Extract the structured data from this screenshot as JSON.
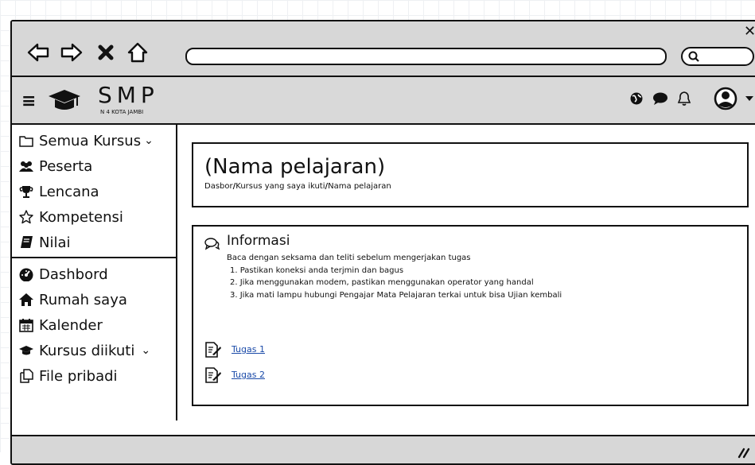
{
  "browser": {
    "back_icon": "back-arrow-icon",
    "forward_icon": "forward-arrow-icon",
    "stop_icon": "close-icon",
    "home_icon": "home-icon",
    "address_value": "",
    "search_icon": "search-icon"
  },
  "header": {
    "logo_title": "SMP",
    "logo_subtitle": "N 4 KOTA JAMBI"
  },
  "sidebar": {
    "items": [
      {
        "label": "Semua Kursus",
        "icon": "folder-icon"
      },
      {
        "label": "Peserta",
        "icon": "users-icon"
      },
      {
        "label": "Lencana",
        "icon": "trophy-icon"
      },
      {
        "label": "Kompetensi",
        "icon": "star-icon"
      },
      {
        "label": "Nilai",
        "icon": "book-icon"
      },
      {
        "label": "Dashbord",
        "icon": "dashboard-icon"
      },
      {
        "label": "Rumah saya",
        "icon": "home-icon"
      },
      {
        "label": "Kalender",
        "icon": "calendar-icon"
      },
      {
        "label": "Kursus diikuti",
        "icon": "graduation-cap-icon"
      },
      {
        "label": "File pribadi",
        "icon": "files-icon"
      }
    ]
  },
  "main": {
    "title": "(Nama pelajaran)",
    "breadcrumb": [
      "Dasbor",
      "Kursus yang saya ikuti",
      "Nama pelajaran"
    ],
    "info": {
      "heading": "Informasi",
      "lines": [
        "Baca dengan seksama dan teliti sebelum mengerjakan tugas",
        "1. Pastikan koneksi anda terjmin dan bagus",
        "2. Jika menggunakan modem, pastikan menggunakan operator yang handal",
        "3. Jika mati lampu hubungi Pengajar Mata Pelajaran terkai untuk bisa Ujian kembali"
      ],
      "tasks": [
        "Tugas 1",
        "Tugas 2"
      ]
    }
  }
}
